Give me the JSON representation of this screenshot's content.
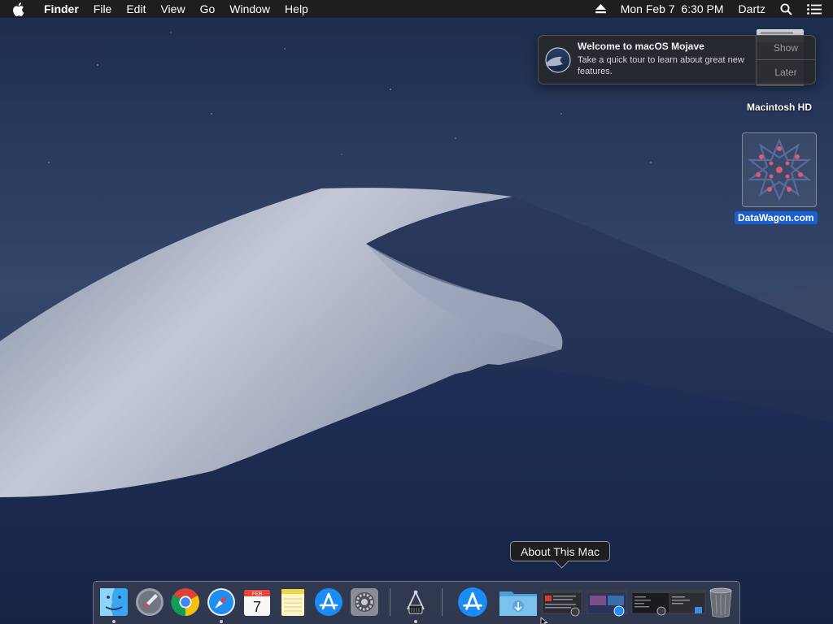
{
  "menubar": {
    "app_name": "Finder",
    "menus": [
      "File",
      "Edit",
      "View",
      "Go",
      "Window",
      "Help"
    ],
    "clock": "Mon Feb 7  6:30 PM",
    "user": "Dartz",
    "icons": {
      "apple": "apple-logo-icon",
      "eject": "eject-icon",
      "spotlight": "search-icon",
      "notification_center": "list-icon"
    }
  },
  "notification": {
    "title": "Welcome to macOS Mojave",
    "body": "Take a quick tour to learn about great new features.",
    "actions": {
      "show": "Show",
      "later": "Later"
    }
  },
  "desktop_icons": [
    {
      "name": "Macintosh HD",
      "icon": "hard-drive-icon"
    },
    {
      "name": "DataWagon.com",
      "icon": "datawagon-image-icon",
      "selected": true
    }
  ],
  "tooltip": {
    "text": "About This Mac"
  },
  "dock": {
    "calendar": {
      "month": "FEB",
      "day": "7"
    },
    "items": [
      {
        "id": "finder",
        "icon": "finder-icon",
        "running": true
      },
      {
        "id": "launchpad",
        "icon": "launchpad-icon",
        "running": false
      },
      {
        "id": "chrome",
        "icon": "chrome-icon",
        "running": false
      },
      {
        "id": "safari",
        "icon": "safari-icon",
        "running": true
      },
      {
        "id": "calendar",
        "icon": "calendar-icon",
        "running": false
      },
      {
        "id": "notes",
        "icon": "notes-icon",
        "running": false
      },
      {
        "id": "app-store",
        "icon": "app-store-icon",
        "running": false
      },
      {
        "id": "system-preferences",
        "icon": "gear-icon",
        "running": false
      },
      {
        "id": "dock-app-running",
        "icon": "dock-app-icon",
        "running": true
      },
      {
        "id": "app-store-minimized",
        "icon": "app-store-icon",
        "running": false
      },
      {
        "id": "downloads",
        "icon": "downloads-folder-icon",
        "running": false
      },
      {
        "id": "window-thumbnail-1",
        "icon": "window-thumbnail-icon",
        "running": false
      },
      {
        "id": "window-thumbnail-2",
        "icon": "window-thumbnail-icon",
        "running": false
      },
      {
        "id": "window-thumbnail-3",
        "icon": "window-thumbnail-icon",
        "running": false
      },
      {
        "id": "window-thumbnail-4",
        "icon": "window-thumbnail-icon",
        "running": false
      },
      {
        "id": "trash",
        "icon": "trash-icon",
        "running": false
      }
    ]
  },
  "colors": {
    "menubar_bg": "#1e1e20",
    "selection_blue": "#1b5fce",
    "sky_dark": "#1b2a4c",
    "dune_light": "#b8bfd0"
  }
}
